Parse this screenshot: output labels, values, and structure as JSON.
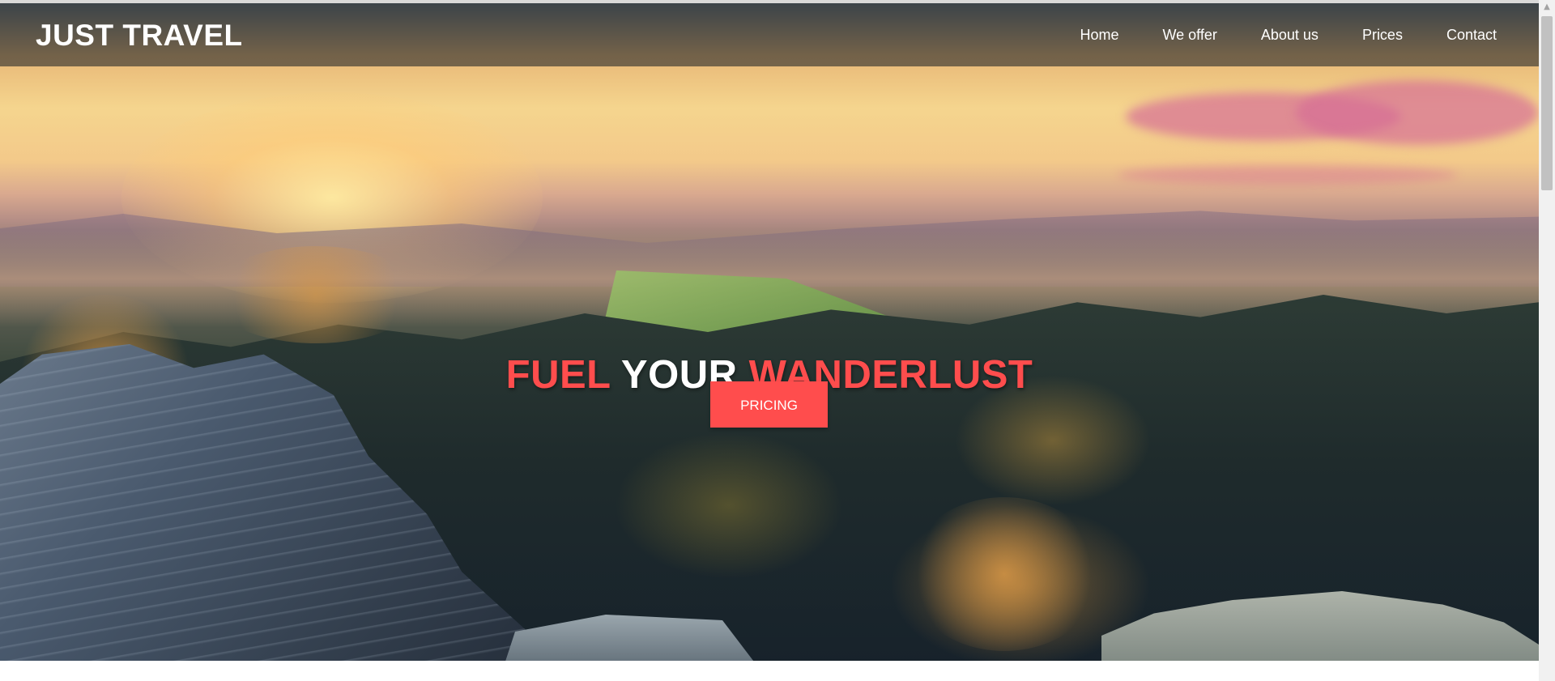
{
  "brand": {
    "name": "JUST TRAVEL"
  },
  "nav": {
    "items": [
      {
        "label": "Home"
      },
      {
        "label": "We offer"
      },
      {
        "label": "About us"
      },
      {
        "label": "Prices"
      },
      {
        "label": "Contact"
      }
    ]
  },
  "hero": {
    "title_words": [
      "FUEL",
      "YOUR",
      "WANDERLUST"
    ],
    "cta_label": "PRICING",
    "background_description_icon": "landscape-photo"
  },
  "colors": {
    "accent": "#ff4d4d",
    "navbar_bg": "rgba(60,58,52,0.68)",
    "text_light": "#ffffff"
  },
  "scrollbar": {
    "up_arrow_icon": "triangle-up-icon"
  }
}
